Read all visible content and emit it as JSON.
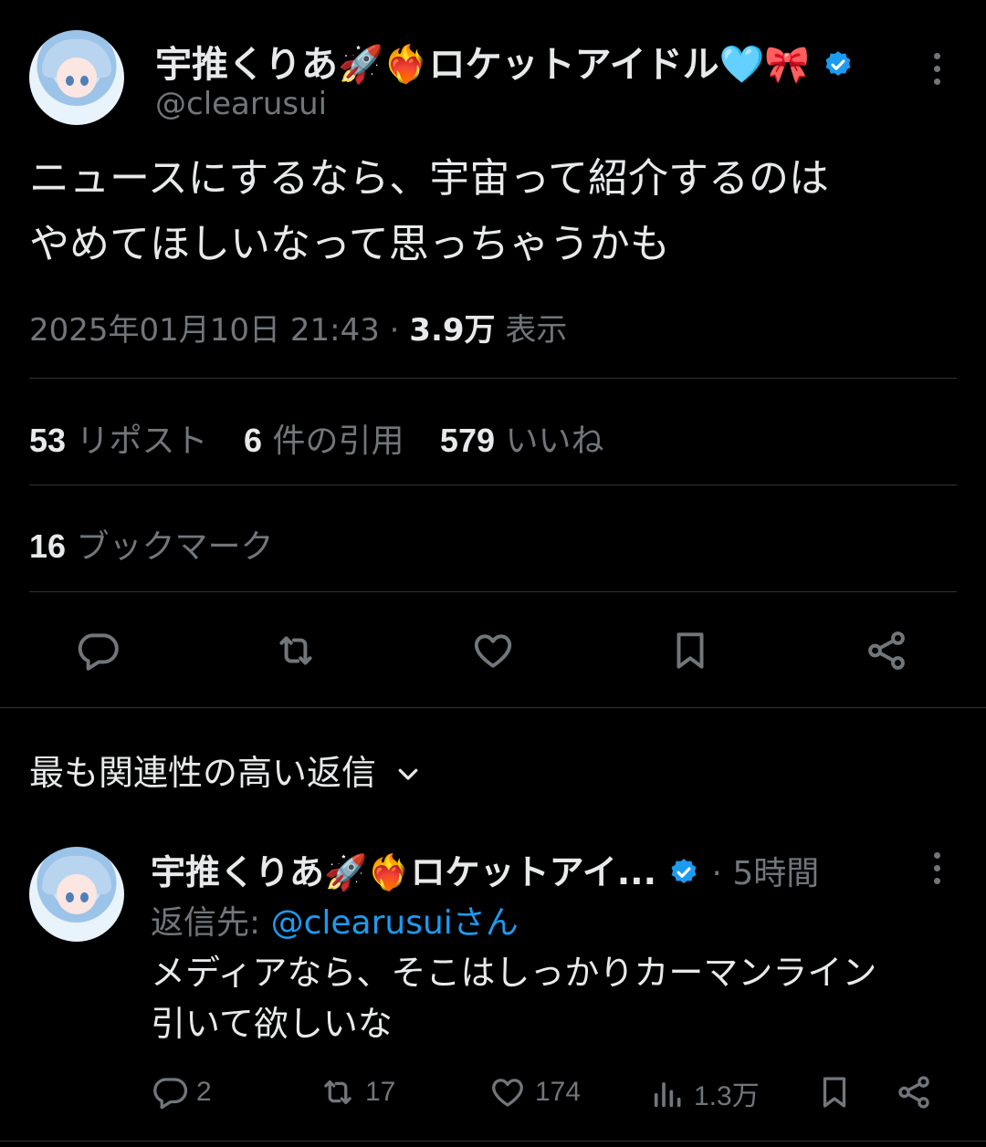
{
  "tweet": {
    "display_name": "宇推くりあ🚀❤️‍🔥ロケットアイドル🩵🎀",
    "handle": "@clearusui",
    "text_line1": "ニュースにするなら、宇宙って紹介するのは",
    "text_line2": "やめてほしいなって思っちゃうかも",
    "date": "2025年01月10日 21:43",
    "dot": "·",
    "views_count": "3.9万",
    "views_label": "表示",
    "reposts_count": "53",
    "reposts_label": "リポスト",
    "quotes_count": "6",
    "quotes_label": "件の引用",
    "likes_count": "579",
    "likes_label": "いいね",
    "bookmarks_count": "16",
    "bookmarks_label": "ブックマーク"
  },
  "replies_sort": {
    "label": "最も関連性の高い返信"
  },
  "reply": {
    "display_name": "宇推くりあ🚀❤️‍🔥ロケットアイ...",
    "time": "· 5時間",
    "reply_to_prefix": "返信先: ",
    "reply_to_handle": "@clearusui",
    "reply_to_suffix": "さん",
    "text_line1": "メディアなら、そこはしっかりカーマンライン",
    "text_line2": "引いて欲しいな",
    "replies": "2",
    "reposts": "17",
    "likes": "174",
    "views": "1.3万"
  },
  "colors": {
    "background": "#000000",
    "text": "#e7e9ea",
    "muted": "#71767b",
    "accent": "#1d9bf0",
    "divider": "#2f3336"
  },
  "icons": [
    "verified-badge-icon",
    "more-icon",
    "reply-icon",
    "repost-icon",
    "like-icon",
    "bookmark-icon",
    "share-icon",
    "chevron-down-icon",
    "views-icon"
  ]
}
